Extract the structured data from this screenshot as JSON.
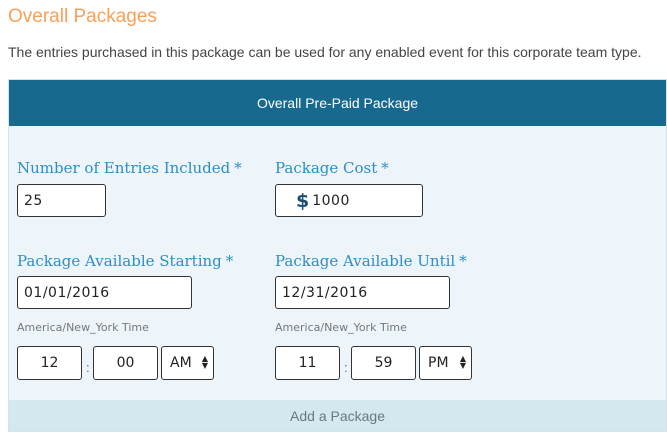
{
  "section": {
    "title": "Overall Packages",
    "description": "The entries purchased in this package can be used for any enabled event for this corporate team type."
  },
  "panel": {
    "header": "Overall Pre-Paid Package",
    "required_marker": "*",
    "entries": {
      "label": "Number of Entries Included",
      "value": "25"
    },
    "cost": {
      "label": "Package Cost",
      "currency_symbol": "$",
      "value": "1000"
    },
    "start": {
      "label": "Package Available Starting",
      "date": "01/01/2016",
      "timezone": "America/New_York Time",
      "hour": "12",
      "minute": "00",
      "ampm": "AM"
    },
    "until": {
      "label": "Package Available Until",
      "date": "12/31/2016",
      "timezone": "America/New_York Time",
      "hour": "11",
      "minute": "59",
      "ampm": "PM"
    },
    "time_separator": ":",
    "add_label": "Add a Package"
  },
  "colors": {
    "title": "#f5a15a",
    "header_bg": "#17698e",
    "label": "#2b8fc8",
    "panel_bg": "#edf4fa",
    "add_bg": "#d4e8f0"
  }
}
